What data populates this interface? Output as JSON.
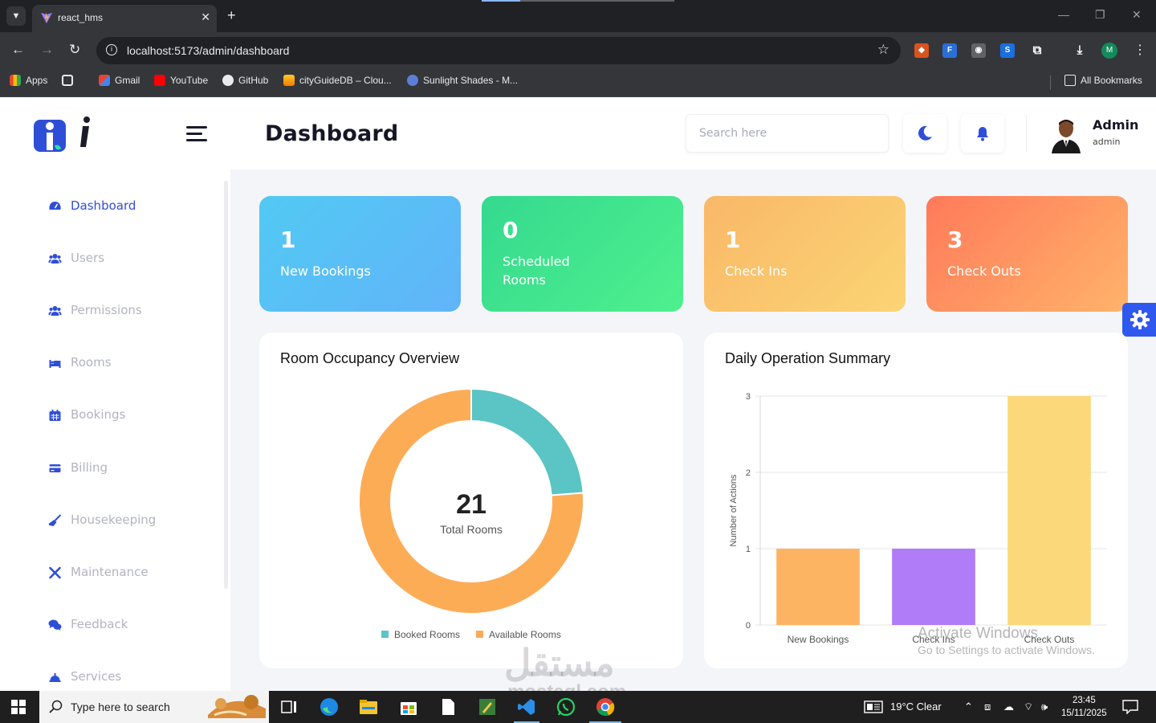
{
  "browser": {
    "tab_title": "react_hms",
    "url": "localhost:5173/admin/dashboard",
    "loading_progress": 0.2,
    "bookmarks": [
      {
        "label": "Apps",
        "icon": "apps-grid-icon"
      },
      {
        "label": "Gmail",
        "icon": "gmail-icon"
      },
      {
        "label": "YouTube",
        "icon": "youtube-icon"
      },
      {
        "label": "GitHub",
        "icon": "github-icon"
      },
      {
        "label": "cityGuideDB – Clou...",
        "icon": "firebase-icon"
      },
      {
        "label": "Sunlight Shades - M...",
        "icon": "site-icon"
      }
    ],
    "all_bookmarks": "All Bookmarks",
    "profile_initial": "M"
  },
  "header": {
    "title": "Dashboard",
    "search_placeholder": "Search here",
    "user_name": "Admin",
    "user_role": "admin"
  },
  "sidebar": {
    "items": [
      {
        "label": "Dashboard",
        "icon": "dashboard-gauge-icon",
        "active": true
      },
      {
        "label": "Users",
        "icon": "users-icon"
      },
      {
        "label": "Permissions",
        "icon": "permissions-icon"
      },
      {
        "label": "Rooms",
        "icon": "bed-icon"
      },
      {
        "label": "Bookings",
        "icon": "calendar-icon"
      },
      {
        "label": "Billing",
        "icon": "credit-card-icon"
      },
      {
        "label": "Housekeeping",
        "icon": "broom-icon"
      },
      {
        "label": "Maintenance",
        "icon": "tools-icon"
      },
      {
        "label": "Feedback",
        "icon": "comments-icon"
      },
      {
        "label": "Services",
        "icon": "bell-service-icon"
      }
    ]
  },
  "stats": [
    {
      "value": "1",
      "label": "New Bookings"
    },
    {
      "value": "0",
      "label": "Scheduled Rooms"
    },
    {
      "value": "1",
      "label": "Check Ins"
    },
    {
      "value": "3",
      "label": "Check Outs"
    }
  ],
  "colors": {
    "accent": "#2f4ed8",
    "booked": "#5bc4c4",
    "available": "#fdac56",
    "bar_new_bookings": "#fdb462",
    "bar_check_ins": "#b07cf7",
    "bar_check_outs": "#fbd87a"
  },
  "chart_data": [
    {
      "type": "pie",
      "title": "Room Occupancy Overview",
      "center_value": "21",
      "center_label": "Total Rooms",
      "categories": [
        "Booked Rooms",
        "Available Rooms"
      ],
      "values": [
        5,
        16
      ],
      "legend": "bottom"
    },
    {
      "type": "bar",
      "title": "Daily Operation Summary",
      "categories": [
        "New Bookings",
        "Check Ins",
        "Check Outs"
      ],
      "values": [
        1,
        1,
        3
      ],
      "ylabel": "Number of Actions",
      "ylim": [
        0,
        3
      ],
      "yticks": [
        "0",
        "1",
        "2",
        "3"
      ],
      "grid": true
    }
  ],
  "overlay": {
    "activate_title": "Activate Windows",
    "activate_sub": "Go to Settings to activate Windows.",
    "watermark": "مستقل",
    "watermark_sub": "mostaql.com"
  },
  "taskbar": {
    "search_text": "Type here to search",
    "weather": "19°C  Clear",
    "time": "23:45",
    "date": "15/11/2025"
  }
}
